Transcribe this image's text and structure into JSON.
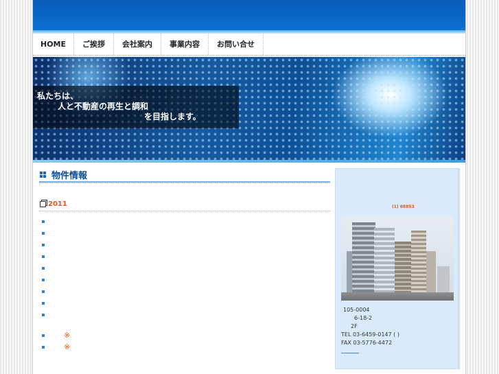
{
  "nav": {
    "items": [
      {
        "label": "HOME"
      },
      {
        "label": "ご挨拶"
      },
      {
        "label": "会社案内"
      },
      {
        "label": "事業内容"
      },
      {
        "label": "お問い合せ"
      }
    ]
  },
  "hero": {
    "line1": "私たちは、",
    "line2": "人と不動産の再生と調和",
    "line3": "を目指します。"
  },
  "main": {
    "section_title": "物件情報",
    "year": "2011",
    "star_mark": "※"
  },
  "sidebar": {
    "caption": "(1) 88853",
    "address": {
      "zip": "105-0004",
      "street": "6-18-2",
      "floor": "2F",
      "tel": "TEL 03-6459-0147 ( )",
      "fax": "FAX 03-5776-4472"
    }
  },
  "colors": {
    "accent": "#0a6fd0",
    "highlight": "#e0561b"
  }
}
